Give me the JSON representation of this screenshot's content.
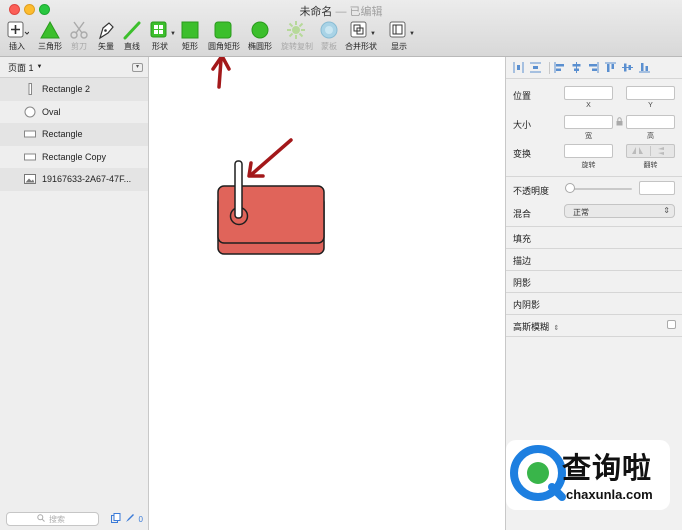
{
  "window": {
    "title": "未命名",
    "subtitle": "— 已编辑"
  },
  "toolbar": {
    "items": [
      {
        "label": "插入",
        "icon": "plus-square-icon"
      },
      {
        "label": "三角形",
        "icon": "triangle-icon"
      },
      {
        "label": "剪刀",
        "icon": "scissors-icon"
      },
      {
        "label": "矢量",
        "icon": "pen-icon"
      },
      {
        "label": "直线",
        "icon": "line-icon"
      },
      {
        "label": "形状",
        "icon": "shapes-icon"
      },
      {
        "label": "矩形",
        "icon": "rectangle-icon"
      },
      {
        "label": "圆角矩形",
        "icon": "rounded-rectangle-icon"
      },
      {
        "label": "椭圆形",
        "icon": "oval-icon"
      },
      {
        "label": "旋转复制",
        "icon": "rotate-copy-icon"
      },
      {
        "label": "蒙板",
        "icon": "mask-icon"
      },
      {
        "label": "合并形状",
        "icon": "combine-shapes-icon"
      },
      {
        "label": "显示",
        "icon": "view-icon"
      }
    ]
  },
  "sidebar": {
    "page_label": "页面 1",
    "layers": [
      {
        "name": "Rectangle 2",
        "icon": "thin-rectangle-icon"
      },
      {
        "name": "Oval",
        "icon": "oval-layer-icon"
      },
      {
        "name": "Rectangle",
        "icon": "rectangle-layer-icon"
      },
      {
        "name": "Rectangle Copy",
        "icon": "rectangle-layer-icon"
      },
      {
        "name": "19167633-2A67-47F...",
        "icon": "image-layer-icon"
      }
    ],
    "search_placeholder": "搜索",
    "edit_count": "0"
  },
  "inspector": {
    "position_label": "位置",
    "x_label": "X",
    "y_label": "Y",
    "size_label": "大小",
    "width_label": "宽",
    "height_label": "高",
    "transform_label": "变换",
    "rotate_label": "旋转",
    "flip_label": "翻转",
    "opacity_label": "不透明度",
    "blend_label": "混合",
    "blend_value": "正常",
    "sections": [
      "填充",
      "描边",
      "阴影",
      "内阴影"
    ],
    "blur_label": "高斯模糊"
  },
  "watermark": {
    "brand": "查询啦",
    "url": "chaxunla.com"
  },
  "colors": {
    "shape_fill": "#e0645a",
    "shape_stroke": "#1f1f1f",
    "arrow": "#a3181a",
    "accent_green": "#3cbf2c",
    "brand_blue": "#1d7fe0"
  }
}
